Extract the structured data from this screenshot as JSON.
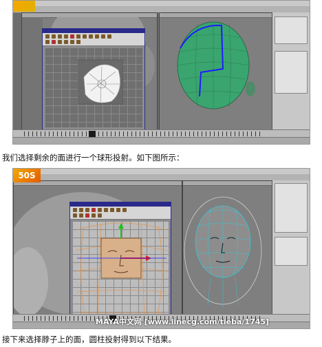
{
  "captions": {
    "first": "我们选择剩余的面进行一个球形投射。如下图所示：",
    "second": "接下来选择脖子上的面，圆柱投射得到以下结果。"
  },
  "screenshot2": {
    "logo_text": "50S",
    "watermark": "MAYA中文网  [www.linecg.com/tieba/1745]"
  },
  "colors": {
    "uv_window_border": "#2a2a8a",
    "selection_blue": "#1c1cff",
    "wireframe_green": "#3aa56f",
    "projection_orange": "#f08a30",
    "manipulator_red": "#e02020",
    "manipulator_green": "#20c020",
    "head_cyan": "#35c8d8"
  },
  "icons": [
    "maya-logo-icon",
    "uv-texture-editor-window",
    "sphere-projection-icon",
    "cylindrical-projection-icon",
    "move-manipulator-icon"
  ]
}
